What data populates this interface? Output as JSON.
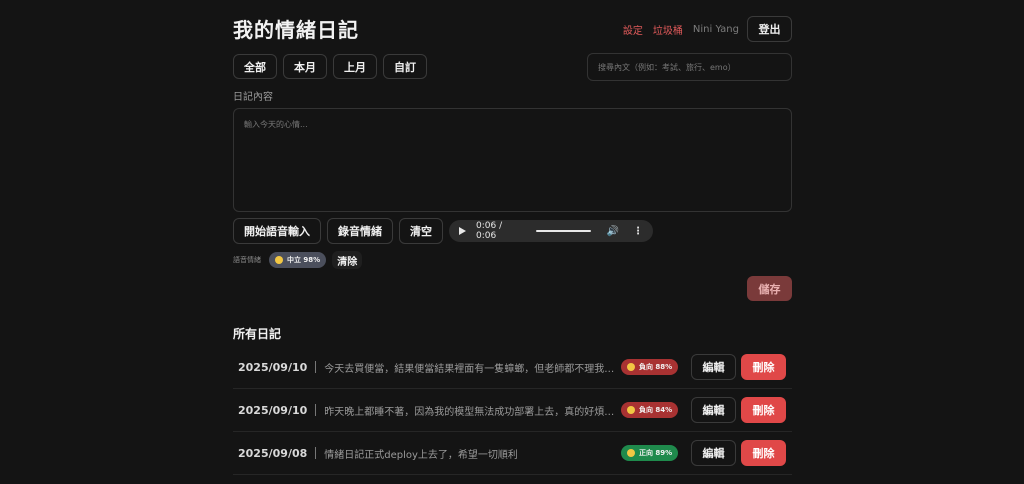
{
  "header": {
    "title": "我的情緒日記",
    "settings": "設定",
    "trash": "垃圾桶",
    "user": "Nini Yang",
    "logout": "登出"
  },
  "filters": [
    "全部",
    "本月",
    "上月",
    "自訂"
  ],
  "search": {
    "placeholder": "搜尋內文（例如：考試、旅行、emo）",
    "value": ""
  },
  "editor": {
    "label": "日記內容",
    "placeholder": "輸入今天的心情...",
    "value": ""
  },
  "voice": {
    "start_label": "開始語音輸入",
    "record_label": "錄音情緒",
    "clear_label": "清空",
    "audio_time": "0:06 / 0:06"
  },
  "voice_emotion": {
    "label": "語音情緒",
    "badge": "中立 98%",
    "clear_label": "清除"
  },
  "save_label": "儲存",
  "entries_title": "所有日記",
  "entries": [
    {
      "date": "2025/09/10",
      "text": "今天去買便當，結果便當結果裡面有一隻蟑螂，但老師都不理我，害我氣到吃不下",
      "badge": "負向 88%",
      "sentiment": "negative",
      "edit": "編輯",
      "delete": "刪除"
    },
    {
      "date": "2025/09/10",
      "text": "昨天晚上都睡不著，因為我的模型無法成功部署上去，真的好煩好焦慮",
      "badge": "負向 84%",
      "sentiment": "negative",
      "edit": "編輯",
      "delete": "刪除"
    },
    {
      "date": "2025/09/08",
      "text": "情緒日記正式deploy上去了，希望一切順利",
      "badge": "正向 89%",
      "sentiment": "positive",
      "edit": "編輯",
      "delete": "刪除"
    }
  ],
  "colors": {
    "background": "#141414",
    "accent_red": "#e04848",
    "negative": "#a83232",
    "positive": "#1f8a4c",
    "neutral": "#4b4f5c"
  }
}
